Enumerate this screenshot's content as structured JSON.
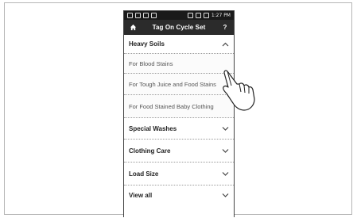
{
  "app_bar": {
    "title": "Tag On Cycle Set",
    "help_label": "?"
  },
  "status_bar": {
    "time": "1:27 PM"
  },
  "menu": {
    "sections": [
      {
        "label": "Heavy Soils",
        "expanded": true,
        "icon": "chevron-up-icon"
      },
      {
        "label": "Special Washes",
        "expanded": false,
        "icon": "chevron-down-icon"
      },
      {
        "label": "Clothing Care",
        "expanded": false,
        "icon": "chevron-down-icon"
      },
      {
        "label": "Load Size",
        "expanded": false,
        "icon": "chevron-down-icon"
      },
      {
        "label": "View all",
        "expanded": false,
        "icon": "chevron-down-icon"
      }
    ],
    "sub_items": [
      {
        "label": "For Blood Stains"
      },
      {
        "label": "For Tough Juice and Food Stains"
      },
      {
        "label": "For Food Stained Baby Clothing"
      }
    ]
  },
  "icons": {
    "home": "home-icon",
    "hand": "pointing-hand-icon"
  }
}
